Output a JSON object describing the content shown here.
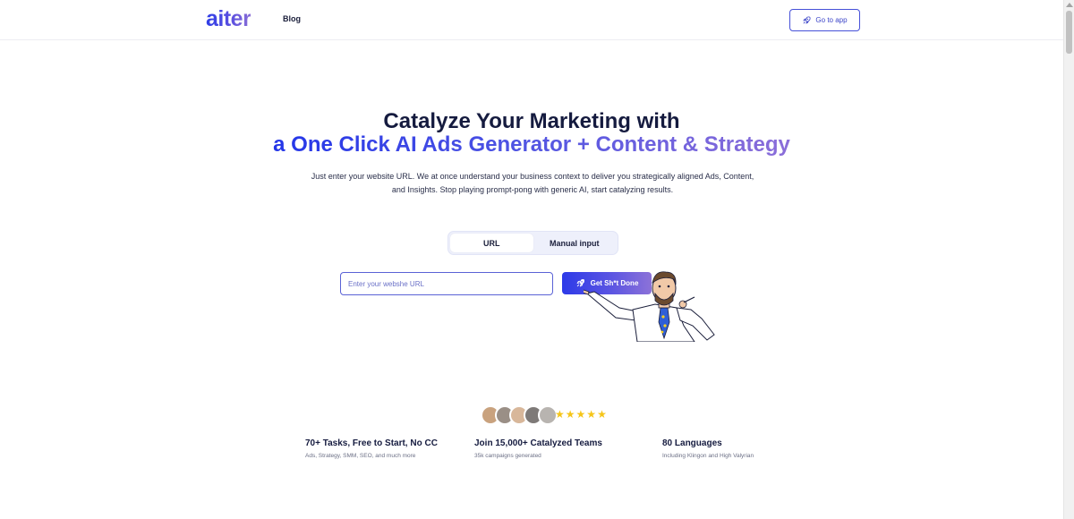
{
  "header": {
    "logo": "aiter",
    "nav": {
      "blog_label": "Blog"
    },
    "goto_app_label": "Go to app"
  },
  "hero": {
    "title_line1": "Catalyze Your Marketing with",
    "title_line2": "a One Click AI Ads Generator + Content & Strategy",
    "subtitle": "Just enter your website URL. We at once understand your business context to deliver you strategically aligned Ads, Content, and Insights. Stop playing prompt-pong with generic AI, start catalyzing results."
  },
  "input_mode": {
    "tabs": [
      {
        "label": "URL",
        "active": true
      },
      {
        "label": "Manual input",
        "active": false
      }
    ]
  },
  "url_form": {
    "placeholder": "Enter your webshe URL",
    "value": "",
    "submit_label": "Get Sh*t Done"
  },
  "social_proof": {
    "avatar_count": 5,
    "rating_stars": 5,
    "star_color": "#f5c518",
    "stats": [
      {
        "title": "70+ Tasks, Free to Start, No CC",
        "subtitle": "Ads, Strategy, SMM, SEO, and much more"
      },
      {
        "title": "Join 15,000+ Catalyzed Teams",
        "subtitle": "35k campaigns generated"
      },
      {
        "title": "80 Languages",
        "subtitle": "Including Klingon and High Valyrian"
      }
    ]
  },
  "colors": {
    "brand_blue": "#2d3ae8",
    "brand_purple": "#8c72d8",
    "text_dark": "#151b3f"
  },
  "icons": {
    "goto_app": "rocket-icon",
    "cta": "rocket-icon"
  }
}
